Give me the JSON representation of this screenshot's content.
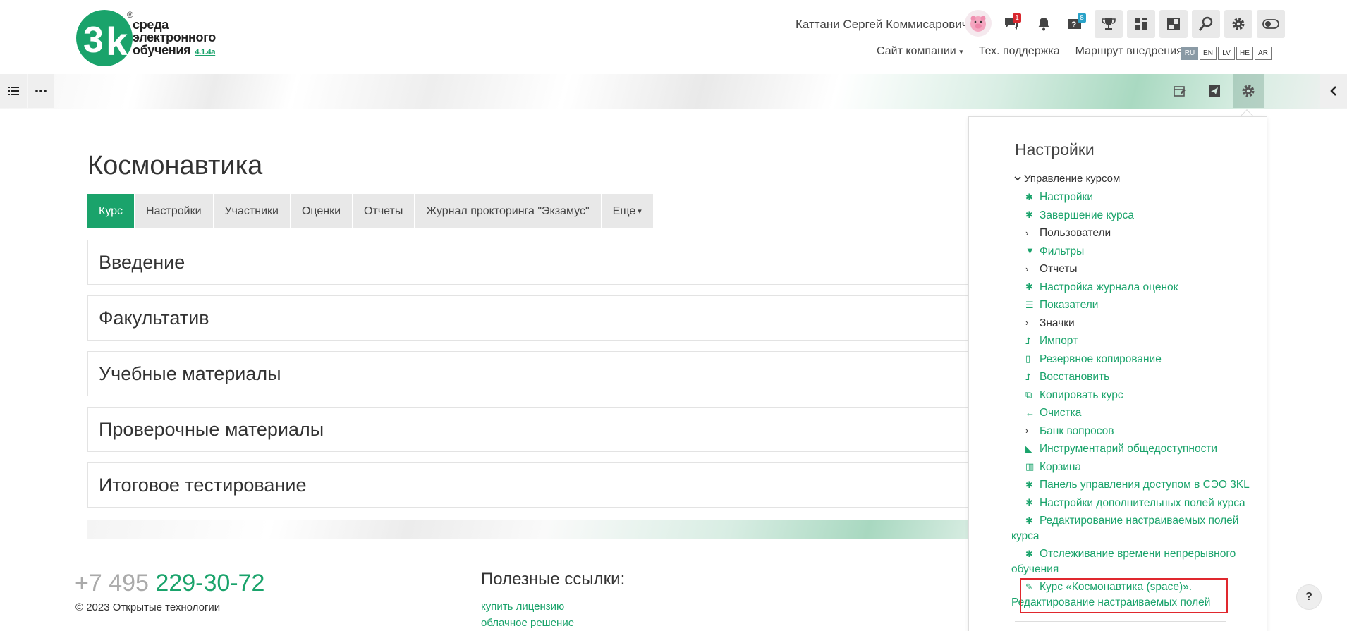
{
  "logo": {
    "line1": "среда",
    "line2": "электронного",
    "line3": "обучения",
    "version": "4.1.4a",
    "registered": "®"
  },
  "header": {
    "user_name": "Каттани Сергей Коммисарович",
    "messages_badge": "1",
    "help_badge": "8",
    "links": {
      "company_site": "Сайт компании",
      "support": "Тех. поддержка",
      "route": "Маршрут внедрения"
    },
    "languages": [
      "RU",
      "EN",
      "LV",
      "HE",
      "AR"
    ],
    "active_language": "RU"
  },
  "course": {
    "title": "Космонавтика",
    "tabs": [
      "Курс",
      "Настройки",
      "Участники",
      "Оценки",
      "Отчеты",
      "Журнал прокторинга \"Экзамус\"",
      "Еще"
    ],
    "active_tab": "Курс",
    "sections": [
      "Введение",
      "Факультатив",
      "Учебные материалы",
      "Проверочные материалы",
      "Итоговое тестирование"
    ]
  },
  "footer": {
    "phone_prefix": "+7 495",
    "phone_number": "229-30-72",
    "copyright": "© 2023  Открытые технологии",
    "links_title": "Полезные ссылки:",
    "links": [
      "купить лицензию",
      "облачное решение"
    ]
  },
  "settings_panel": {
    "title": "Настройки",
    "root": "Управление курсом",
    "items": [
      {
        "label": "Настройки",
        "icon": "gear-icon",
        "link": true
      },
      {
        "label": "Завершение курса",
        "icon": "gear-icon",
        "link": true
      },
      {
        "label": "Пользователи",
        "icon": "chevron-right-icon",
        "link": false
      },
      {
        "label": "Фильтры",
        "icon": "filter-icon",
        "link": true
      },
      {
        "label": "Отчеты",
        "icon": "chevron-right-icon",
        "link": false
      },
      {
        "label": "Настройка журнала оценок",
        "icon": "gear-icon",
        "link": true
      },
      {
        "label": "Показатели",
        "icon": "list-icon",
        "link": true
      },
      {
        "label": "Значки",
        "icon": "chevron-right-icon",
        "link": false
      },
      {
        "label": "Импорт",
        "icon": "upload-icon",
        "link": true
      },
      {
        "label": "Резервное копирование",
        "icon": "file-icon",
        "link": true
      },
      {
        "label": "Восстановить",
        "icon": "upload-icon",
        "link": true
      },
      {
        "label": "Копировать курс",
        "icon": "copy-icon",
        "link": true
      },
      {
        "label": "Очистка",
        "icon": "arrow-left-icon",
        "link": true
      },
      {
        "label": "Банк вопросов",
        "icon": "chevron-right-icon",
        "link": false
      },
      {
        "label": "Инструментарий общедоступности",
        "icon": "area-chart-icon",
        "link": true
      },
      {
        "label": "Корзина",
        "icon": "trash-icon",
        "link": true
      },
      {
        "label": "Панель управления доступом в СЭО 3KL",
        "icon": "gear-icon",
        "link": true
      },
      {
        "label": "Настройки дополнительных полей курса",
        "icon": "gear-icon",
        "link": true
      },
      {
        "label": "Редактирование настраиваемых полей курса",
        "icon": "gear-icon",
        "link": true
      },
      {
        "label": "Отслеживание времени непрерывного обучения",
        "icon": "gear-icon",
        "link": true
      },
      {
        "label": "Курс «Космонавтика (space)». Редактирование настраиваемых полей",
        "icon": "pencil-icon",
        "link": true
      }
    ]
  },
  "help_button": "?",
  "colors": {
    "accent": "#1aa36b",
    "highlight": "#e0282e"
  }
}
